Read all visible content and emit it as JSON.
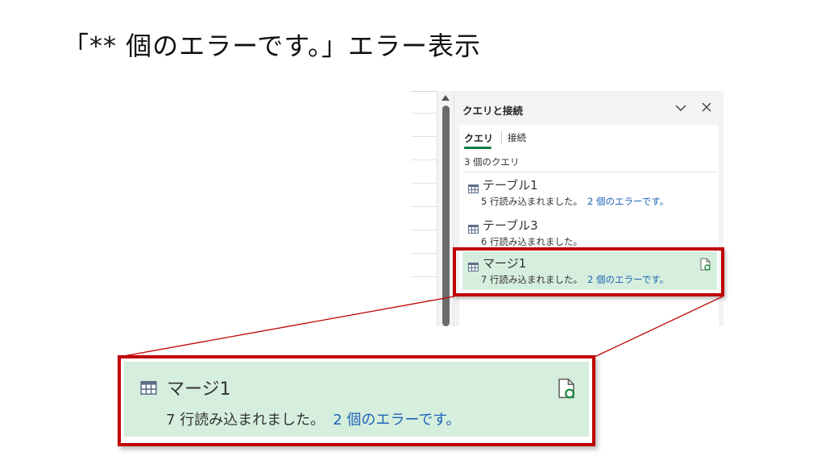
{
  "slide": {
    "title": "「** 個のエラーです。」エラー表示"
  },
  "pane": {
    "header": "クエリと接続",
    "tabs": [
      {
        "label": "クエリ",
        "active": true
      },
      {
        "label": "接続",
        "active": false
      }
    ],
    "query_count": "3 個のクエリ",
    "queries": [
      {
        "name": "テーブル1",
        "status": "5 行読み込まれました。",
        "error_link": "2 個のエラーです。",
        "selected": false
      },
      {
        "name": "テーブル3",
        "status": "6 行読み込まれました。",
        "error_link": "",
        "selected": false
      },
      {
        "name": "マージ1",
        "status": "7 行読み込まれました。",
        "error_link": "2 個のエラーです。",
        "selected": true
      }
    ],
    "icons": {
      "table": "table-icon",
      "refresh": "refresh-document-icon",
      "collapse": "chevron-down-icon",
      "close": "close-icon"
    }
  },
  "zoom": {
    "name": "マージ1",
    "status": "7 行読み込まれました。",
    "error_link": "2 個のエラーです。"
  },
  "colors": {
    "highlight": "#c00000",
    "selected_bg": "#d6eedd",
    "link": "#1f63b8",
    "tab_underline": "#107c41"
  }
}
